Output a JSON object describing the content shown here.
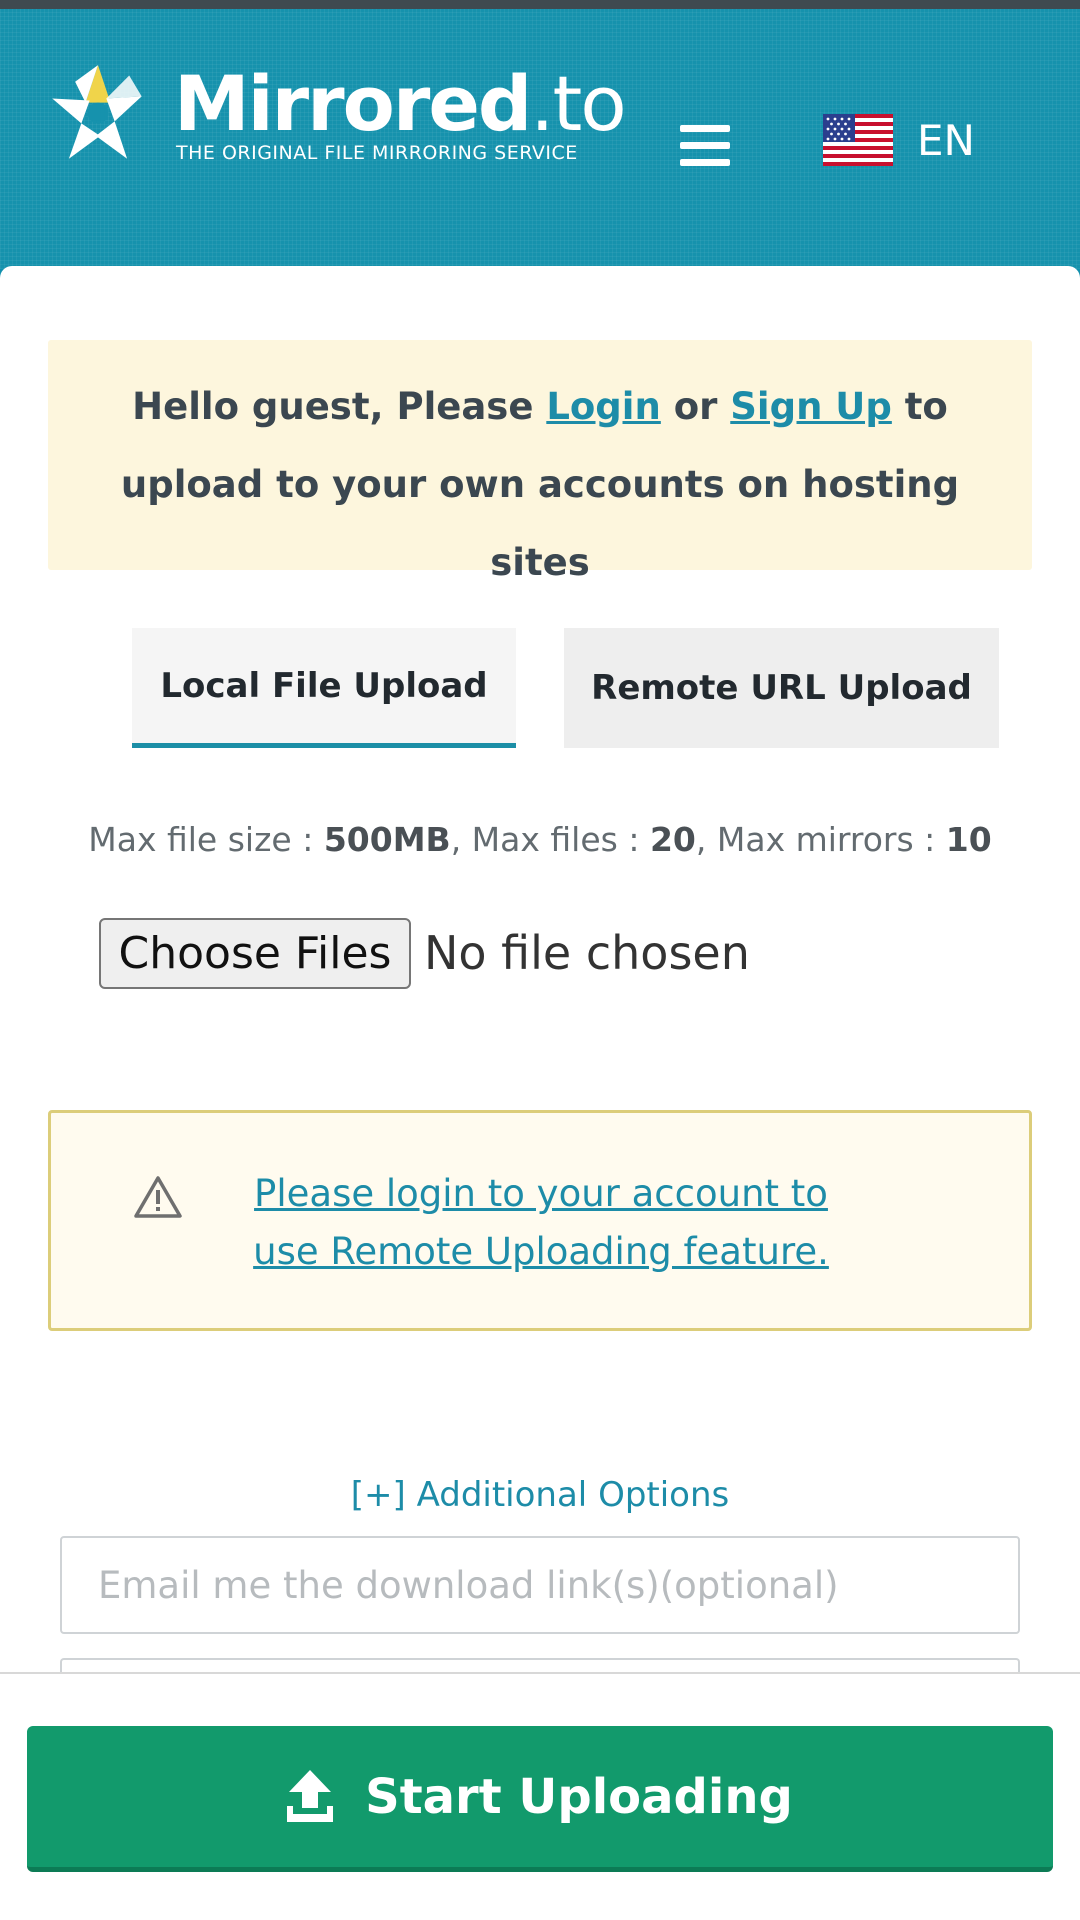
{
  "header": {
    "brand_name": "Mirrored",
    "brand_tld": ".to",
    "tagline": "THE ORIGINAL FILE MIRRORING SERVICE",
    "language": "EN",
    "menu_icon": "hamburger-menu-icon",
    "flag_icon": "us-flag-icon"
  },
  "notice": {
    "text_before": "Hello guest, Please ",
    "login_link": "Login",
    "text_or": " or ",
    "signup_link": "Sign Up",
    "text_after": " to upload to your own accounts on hosting sites"
  },
  "tabs": [
    {
      "label": "Local File Upload",
      "active": true
    },
    {
      "label": "Remote URL Upload",
      "active": false
    }
  ],
  "limits": {
    "size_label": "Max file size : ",
    "size_value": "500MB",
    "files_label": ", Max files : ",
    "files_value": "20",
    "mirrors_label": ", Max mirrors : ",
    "mirrors_value": "10"
  },
  "file_input": {
    "button_label": "Choose Files",
    "status": "No file chosen"
  },
  "warning": {
    "icon": "warning-triangle-icon",
    "link_text": "Please login to your account to use Remote Uploading feature."
  },
  "options": {
    "toggle_label": "[+] Additional Options",
    "email_placeholder": "Email me the download link(s)(optional)"
  },
  "action": {
    "label": "Start Uploading",
    "icon": "upload-arrow-icon"
  },
  "colors": {
    "header_bg": "#1692ad",
    "link": "#1d8ca8",
    "primary_button": "#129a6c",
    "notice_bg": "#fdf6dd"
  }
}
